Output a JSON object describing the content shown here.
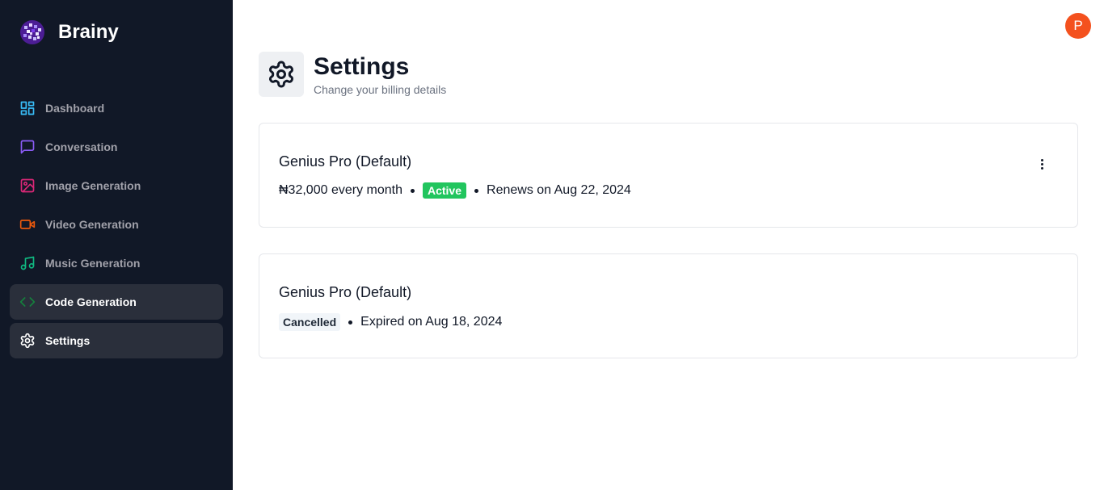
{
  "brand": {
    "name": "Brainy",
    "logo_icon": "brain-logo-icon"
  },
  "sidebar": {
    "items": [
      {
        "label": "Dashboard",
        "icon": "dashboard-icon",
        "color": "#38bdf8",
        "active": false
      },
      {
        "label": "Conversation",
        "icon": "message-square-icon",
        "color": "#8b5cf6",
        "active": false
      },
      {
        "label": "Image Generation",
        "icon": "image-icon",
        "color": "#db2777",
        "active": false
      },
      {
        "label": "Video Generation",
        "icon": "video-icon",
        "color": "#ea580c",
        "active": false
      },
      {
        "label": "Music Generation",
        "icon": "music-icon",
        "color": "#10b981",
        "active": false
      },
      {
        "label": "Code Generation",
        "icon": "code-icon",
        "color": "#15803d",
        "active": true
      },
      {
        "label": "Settings",
        "icon": "settings-icon",
        "color": "#ffffff",
        "active": true
      }
    ]
  },
  "user": {
    "avatar_initial": "P",
    "avatar_color": "#f4511e"
  },
  "header": {
    "title": "Settings",
    "subtitle": "Change your billing details",
    "icon": "settings-icon"
  },
  "subscriptions": [
    {
      "plan": "Genius Pro (Default)",
      "price": "₦32,000 every month",
      "status": "Active",
      "status_color": "#22c55e",
      "date_text": "Renews on Aug 22, 2024",
      "menu_icon": "more-vertical-icon"
    },
    {
      "plan": "Genius Pro (Default)",
      "status": "Cancelled",
      "status_color": "#f1f5f9",
      "date_text": "Expired on Aug 18, 2024"
    }
  ]
}
